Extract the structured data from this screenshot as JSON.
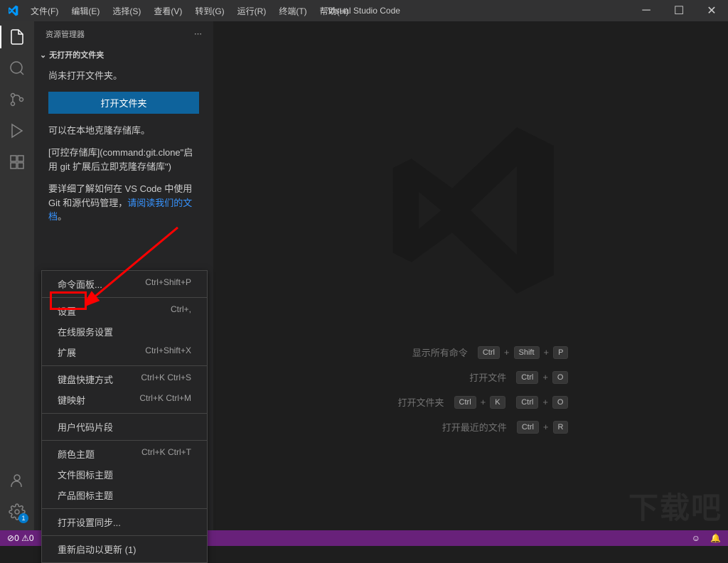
{
  "titlebar": {
    "title": "Visual Studio Code",
    "menus": [
      "文件(F)",
      "编辑(E)",
      "选择(S)",
      "查看(V)",
      "转到(G)",
      "运行(R)",
      "终端(T)",
      "帮助(H)"
    ]
  },
  "sidebar": {
    "header": "资源管理器",
    "section_title": "无打开的文件夹",
    "no_folder_msg": "尚未打开文件夹。",
    "open_folder_btn": "打开文件夹",
    "clone_msg": "可以在本地克隆存储库。",
    "clone_repo_text": "[可控存储库](command:git.clone\"启用 git 扩展后立即克隆存储库\")",
    "learn_more_prefix": "要详细了解如何在 VS Code 中使用 Git 和源代码管理，",
    "learn_more_link": "请阅读我们的文档",
    "learn_more_suffix": "。"
  },
  "shortcuts": {
    "rows": [
      {
        "label": "显示所有命令",
        "keys": [
          "Ctrl",
          "Shift",
          "P"
        ]
      },
      {
        "label": "打开文件",
        "keys": [
          "Ctrl",
          "O"
        ]
      },
      {
        "label": "打开文件夹",
        "keys": [
          "Ctrl",
          "K",
          "Ctrl",
          "O"
        ]
      },
      {
        "label": "打开最近的文件",
        "keys": [
          "Ctrl",
          "R"
        ]
      }
    ]
  },
  "context_menu": {
    "groups": [
      [
        {
          "label": "命令面板...",
          "shortcut": "Ctrl+Shift+P"
        }
      ],
      [
        {
          "label": "设置",
          "shortcut": "Ctrl+,"
        },
        {
          "label": "在线服务设置",
          "shortcut": ""
        },
        {
          "label": "扩展",
          "shortcut": "Ctrl+Shift+X"
        }
      ],
      [
        {
          "label": "键盘快捷方式",
          "shortcut": "Ctrl+K Ctrl+S"
        },
        {
          "label": "键映射",
          "shortcut": "Ctrl+K Ctrl+M"
        }
      ],
      [
        {
          "label": "用户代码片段",
          "shortcut": ""
        }
      ],
      [
        {
          "label": "颜色主题",
          "shortcut": "Ctrl+K Ctrl+T"
        },
        {
          "label": "文件图标主题",
          "shortcut": ""
        },
        {
          "label": "产品图标主题",
          "shortcut": ""
        }
      ],
      [
        {
          "label": "打开设置同步...",
          "shortcut": ""
        }
      ],
      [
        {
          "label": "重新启动以更新 (1)",
          "shortcut": ""
        }
      ]
    ]
  },
  "statusbar": {
    "errors": "0",
    "warnings": "0"
  },
  "activity_badge": "1",
  "watermark_text": "下载吧"
}
